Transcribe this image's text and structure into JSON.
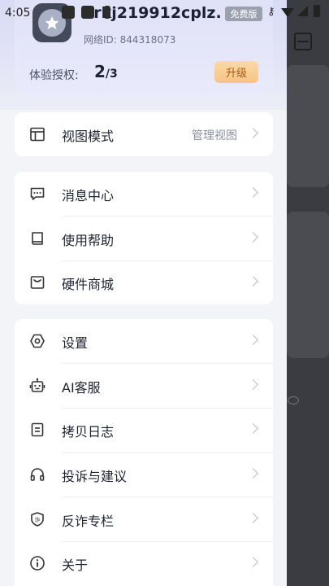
{
  "status_bar": {
    "time": "4:05"
  },
  "profile": {
    "username": "6rkj219912cplz...",
    "badge": "免费版",
    "network_id": "网络ID: 844318073",
    "trial_label": "体验授权:",
    "trial_used": "2",
    "trial_total": "/3",
    "upgrade_label": "升级"
  },
  "menu": {
    "view_mode": {
      "label": "视图模式",
      "value": "管理视图",
      "icon": "layout-icon"
    },
    "group1": [
      {
        "label": "消息中心",
        "icon": "message-icon"
      },
      {
        "label": "使用帮助",
        "icon": "book-icon"
      },
      {
        "label": "硬件商城",
        "icon": "shop-icon"
      }
    ],
    "group2": [
      {
        "label": "设置",
        "icon": "gear-icon"
      },
      {
        "label": "AI客服",
        "icon": "robot-icon"
      },
      {
        "label": "拷贝日志",
        "icon": "log-icon"
      },
      {
        "label": "投诉与建议",
        "icon": "headphones-icon"
      },
      {
        "label": "反诈专栏",
        "icon": "shield-icon"
      },
      {
        "label": "关于",
        "icon": "info-icon"
      }
    ]
  },
  "colors": {
    "accent_upgrade": "#f6c487",
    "upgrade_text": "#a35a12",
    "badge_bg": "#9aa0ae"
  }
}
